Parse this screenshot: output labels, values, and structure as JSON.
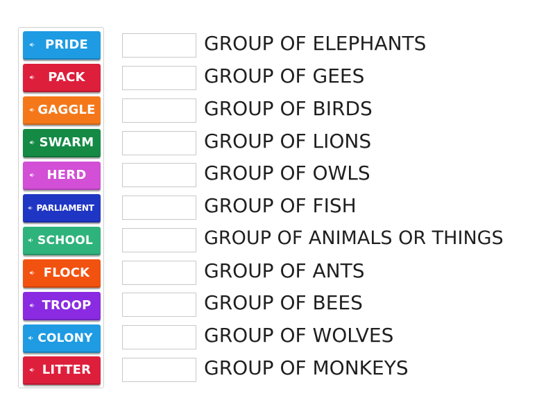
{
  "tiles": [
    {
      "label": "PRIDE",
      "color": "#1e9be2"
    },
    {
      "label": "PACK",
      "color": "#dd1f3c"
    },
    {
      "label": "GAGGLE",
      "color": "#f4781a"
    },
    {
      "label": "SWARM",
      "color": "#148a45"
    },
    {
      "label": "HERD",
      "color": "#d24fd6"
    },
    {
      "label": "PARLIAMENT",
      "color": "#1f36c4"
    },
    {
      "label": "SCHOOL",
      "color": "#2fb37c"
    },
    {
      "label": "FLOCK",
      "color": "#f2520f"
    },
    {
      "label": "TROOP",
      "color": "#8a2be2"
    },
    {
      "label": "COLONY",
      "color": "#1e9be2"
    },
    {
      "label": "LITTER",
      "color": "#dd1f3c"
    }
  ],
  "prompts": [
    "GROUP OF ELEPHANTS",
    "GROUP OF GEES",
    "GROUP OF BIRDS",
    "GROUP OF LIONS",
    "GROUP OF OWLS",
    "GROUP OF FISH",
    "GROUP OF ANIMALS OR THINGS",
    "GROUP OF ANTS",
    "GROUP OF BEES",
    "GROUP OF WOLVES",
    "GROUP OF MONKEYS"
  ],
  "answers": [
    "",
    "",
    "",
    "",
    "",
    "",
    "",
    "",
    "",
    "",
    ""
  ],
  "icons": {
    "tile_icon": "speaker-icon"
  }
}
